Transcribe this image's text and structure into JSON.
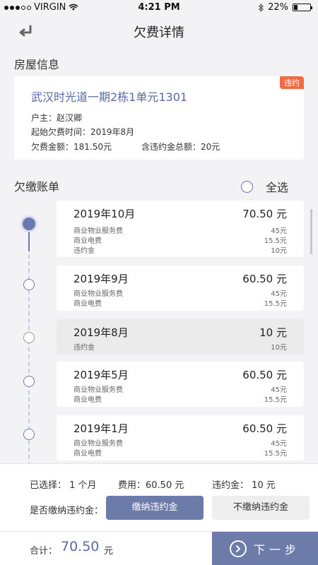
{
  "statusbar": {
    "carrier": "VIRGIN",
    "time": "4:21 PM",
    "battery": "22%",
    "battery_level": 0.22
  },
  "navbar": {
    "title": "欠费详情"
  },
  "house": {
    "section_title": "房屋信息",
    "address": "武汉时光道一期2栋1单元1301",
    "tag": "违约",
    "owner": "户主：赵汉卿",
    "start_time": "起始欠费时间：2019年8月",
    "arrears": "欠费金额：181.50元",
    "penalty_total": "含违约金总额：20元"
  },
  "bills": {
    "section_title": "欠缴账单",
    "select_all": "全选",
    "items": [
      {
        "month": "2019年10月",
        "amount": "70.50 元",
        "rows": [
          {
            "name": "商业物业服务费",
            "value": "45元"
          },
          {
            "name": "商业电费",
            "value": "15.5元"
          },
          {
            "name": "违约金",
            "value": "10元"
          }
        ]
      },
      {
        "month": "2019年9月",
        "amount": "60.50 元",
        "rows": [
          {
            "name": "商业物业服务费",
            "value": "45元"
          },
          {
            "name": "商业电费",
            "value": "15.5元"
          }
        ]
      },
      {
        "month": "2019年8月",
        "amount": "10 元",
        "rows": [
          {
            "name": "违约金",
            "value": "10元"
          }
        ]
      },
      {
        "month": "2019年5月",
        "amount": "60.50 元",
        "rows": [
          {
            "name": "商业物业服务费",
            "value": "45元"
          },
          {
            "name": "商业电费",
            "value": "15.5元"
          }
        ]
      },
      {
        "month": "2019年1月",
        "amount": "60.50 元",
        "rows": [
          {
            "name": "商业物业服务费",
            "value": "45元"
          },
          {
            "name": "商业电费",
            "value": "15.5元"
          }
        ]
      }
    ]
  },
  "summary": {
    "selected": "已选择：  1 个月",
    "fee": "费用：60.50 元",
    "penalty": "违约金：  10 元",
    "question": "是否缴纳违约金：",
    "pay_penalty": "缴纳违约金",
    "no_pay_penalty": "不缴纳违约金"
  },
  "footer": {
    "total_label": "合计：",
    "total_value": "70.50",
    "total_unit": "元",
    "next": "下一步"
  },
  "colors": {
    "accent": "#6d7ba8",
    "tag": "#f26b42",
    "link": "#5a6aa6"
  }
}
